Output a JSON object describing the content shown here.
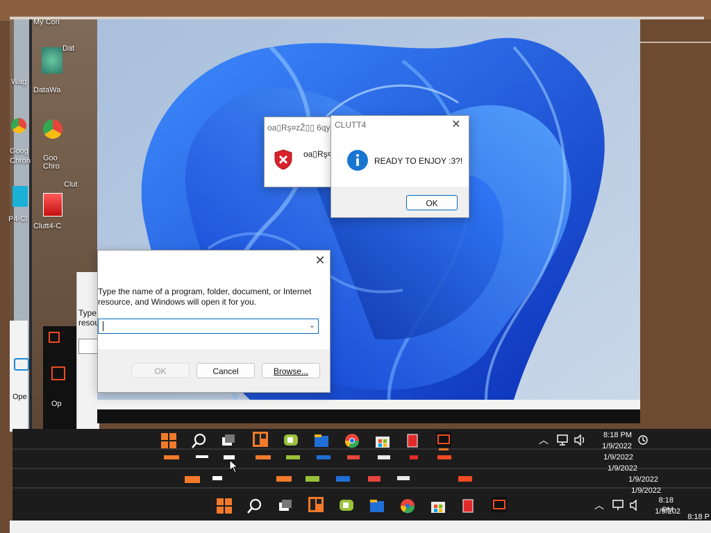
{
  "desktop": {
    "icons": [
      {
        "label": "My Con"
      },
      {
        "label": "Dat"
      },
      {
        "label": "DataWa"
      },
      {
        "label": "Goo Chro"
      },
      {
        "label": "Clut"
      },
      {
        "label": "Clutt4-C"
      }
    ],
    "left_fragments": [
      "Wag",
      "Goog",
      "Chron",
      "P4-Cl",
      "Ope",
      "Op"
    ]
  },
  "error_dialog": {
    "title": "oa▯Rş¤zŽ▯▯ 6qy",
    "message": "oa▯Rş¤z"
  },
  "info_dialog": {
    "title": "CLUTT4",
    "message": "READY TO ENJOY :3?!",
    "ok_label": "OK"
  },
  "run_dialog": {
    "description": "Type the name of a program, folder, document, or Internet resource, and Windows will open it for you.",
    "open_value": "",
    "ok_label": "OK",
    "cancel_label": "Cancel",
    "browse_label": "Browse..."
  },
  "run_dialog_ghost": {
    "line1": "Type",
    "line2": "resou"
  },
  "taskbar": {
    "time": "8:18 PM",
    "date": "1/9/2022",
    "echo_times": [
      "8:18 PM",
      "8:18 P"
    ],
    "echo_dates": [
      "1/9/2022",
      "1/9/2022",
      "1/9/2022",
      "1/9/2022",
      "1/9/202"
    ]
  },
  "colors": {
    "accent": "#0067c0",
    "wallpaper_blue": "#1a56e0",
    "taskbar": "#1c1c1c"
  }
}
